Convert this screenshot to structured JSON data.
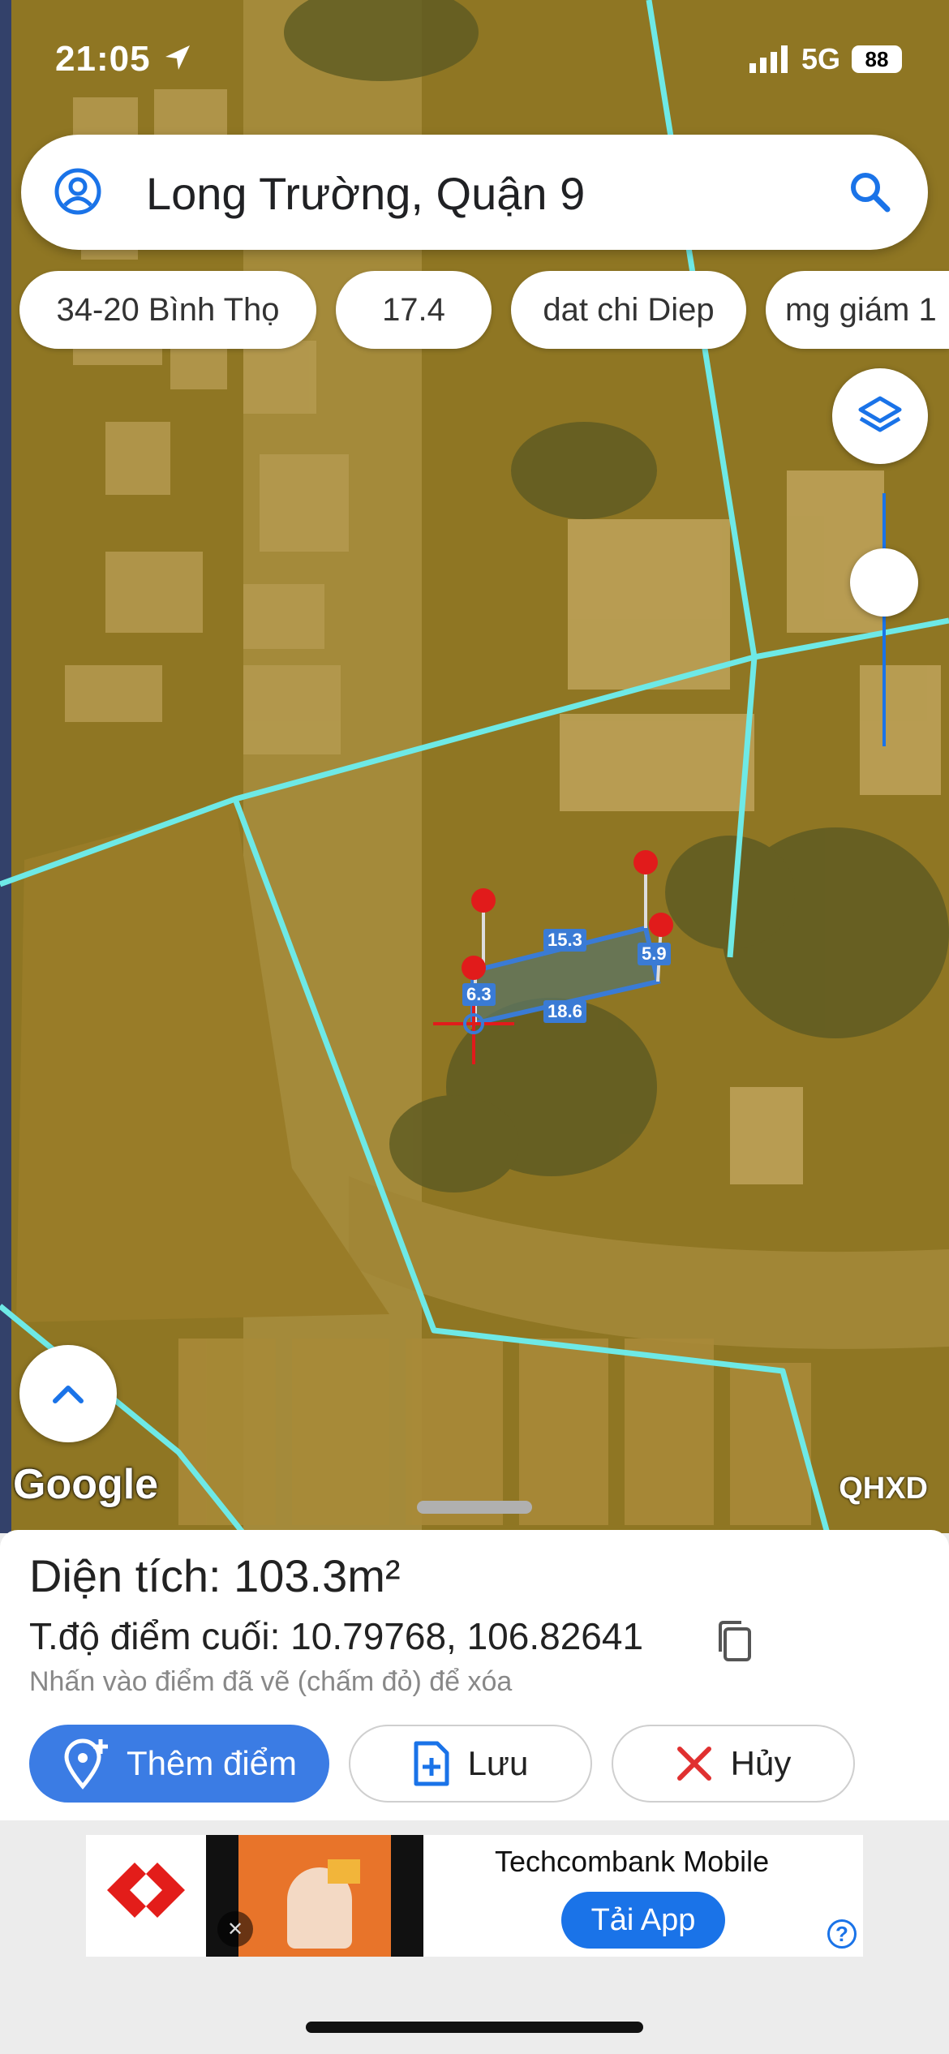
{
  "status": {
    "time": "21:05",
    "network": "5G",
    "battery": "88"
  },
  "search": {
    "text": "Long Trường, Quận 9"
  },
  "chips": [
    "34-20 Bình Thọ",
    "17.4",
    "dat chi Diep",
    "mg giám 1"
  ],
  "map": {
    "edge_labels": [
      "15.3",
      "5.9",
      "18.6",
      "6.3"
    ],
    "google": "Google",
    "overlay": "QHXD",
    "colors": {
      "imagery_tint": "#9c7f22",
      "boundary": "#6ee9e6",
      "measure": "#3a7bd5",
      "pin": "#e11b1b"
    }
  },
  "panel": {
    "area_label": "Diện tích: ",
    "area_value": "103.3m²",
    "coord_label": "T.độ điểm cuối: ",
    "coord_value": "10.79768, 106.82641",
    "hint": "Nhấn vào điểm đã vẽ (chấm đỏ) để xóa",
    "add_label": "Thêm điểm",
    "save_label": "Lưu",
    "cancel_label": "Hủy"
  },
  "ad": {
    "title": "Techcombank Mobile",
    "cta": "Tải App",
    "help": "?"
  }
}
